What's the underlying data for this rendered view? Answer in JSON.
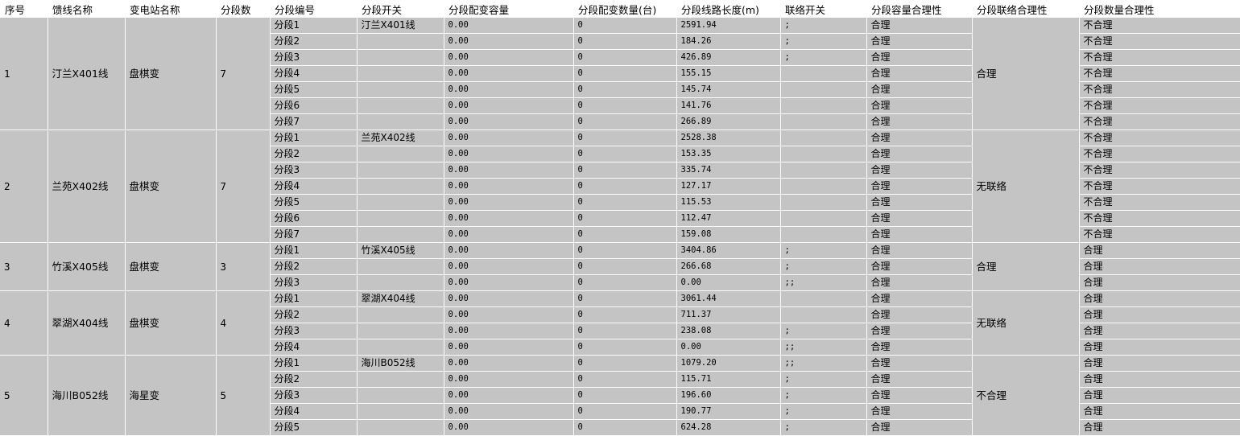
{
  "headers": [
    "序号",
    "馈线名称",
    "变电站名称",
    "分段数",
    "分段编号",
    "分段开关",
    "分段配变容量",
    "分段配变数量(台)",
    "分段线路长度(m)",
    "联络开关",
    "分段容量合理性",
    "分段联络合理性",
    "分段数量合理性"
  ],
  "groups": [
    {
      "index": "1",
      "feeder": "汀兰X401线",
      "substation": "盘棋变",
      "count": "7",
      "link_ok": "合理",
      "rows": [
        {
          "seg": "分段1",
          "switch": "汀兰X401线",
          "cap": "0.00",
          "qty": "0",
          "len": "2591.94",
          "tie": ";",
          "cap_ok": "合理",
          "num_ok": "不合理"
        },
        {
          "seg": "分段2",
          "switch": "",
          "cap": "0.00",
          "qty": "0",
          "len": "184.26",
          "tie": ";",
          "cap_ok": "合理",
          "num_ok": "不合理"
        },
        {
          "seg": "分段3",
          "switch": "",
          "cap": "0.00",
          "qty": "0",
          "len": "426.89",
          "tie": ";",
          "cap_ok": "合理",
          "num_ok": "不合理"
        },
        {
          "seg": "分段4",
          "switch": "",
          "cap": "0.00",
          "qty": "0",
          "len": "155.15",
          "tie": "",
          "cap_ok": "合理",
          "num_ok": "不合理"
        },
        {
          "seg": "分段5",
          "switch": "",
          "cap": "0.00",
          "qty": "0",
          "len": "145.74",
          "tie": "",
          "cap_ok": "合理",
          "num_ok": "不合理"
        },
        {
          "seg": "分段6",
          "switch": "",
          "cap": "0.00",
          "qty": "0",
          "len": "141.76",
          "tie": "",
          "cap_ok": "合理",
          "num_ok": "不合理"
        },
        {
          "seg": "分段7",
          "switch": "",
          "cap": "0.00",
          "qty": "0",
          "len": "266.89",
          "tie": "",
          "cap_ok": "合理",
          "num_ok": "不合理"
        }
      ]
    },
    {
      "index": "2",
      "feeder": "兰苑X402线",
      "substation": "盘棋变",
      "count": "7",
      "link_ok": "无联络",
      "rows": [
        {
          "seg": "分段1",
          "switch": "兰苑X402线",
          "cap": "0.00",
          "qty": "0",
          "len": "2528.38",
          "tie": "",
          "cap_ok": "合理",
          "num_ok": "不合理"
        },
        {
          "seg": "分段2",
          "switch": "",
          "cap": "0.00",
          "qty": "0",
          "len": "153.35",
          "tie": "",
          "cap_ok": "合理",
          "num_ok": "不合理"
        },
        {
          "seg": "分段3",
          "switch": "",
          "cap": "0.00",
          "qty": "0",
          "len": "335.74",
          "tie": "",
          "cap_ok": "合理",
          "num_ok": "不合理"
        },
        {
          "seg": "分段4",
          "switch": "",
          "cap": "0.00",
          "qty": "0",
          "len": "127.17",
          "tie": "",
          "cap_ok": "合理",
          "num_ok": "不合理"
        },
        {
          "seg": "分段5",
          "switch": "",
          "cap": "0.00",
          "qty": "0",
          "len": "115.53",
          "tie": "",
          "cap_ok": "合理",
          "num_ok": "不合理"
        },
        {
          "seg": "分段6",
          "switch": "",
          "cap": "0.00",
          "qty": "0",
          "len": "112.47",
          "tie": "",
          "cap_ok": "合理",
          "num_ok": "不合理"
        },
        {
          "seg": "分段7",
          "switch": "",
          "cap": "0.00",
          "qty": "0",
          "len": "159.08",
          "tie": "",
          "cap_ok": "合理",
          "num_ok": "不合理"
        }
      ]
    },
    {
      "index": "3",
      "feeder": "竹溪X405线",
      "substation": "盘棋变",
      "count": "3",
      "link_ok": "合理",
      "rows": [
        {
          "seg": "分段1",
          "switch": "竹溪X405线",
          "cap": "0.00",
          "qty": "0",
          "len": "3404.86",
          "tie": ";",
          "cap_ok": "合理",
          "num_ok": "合理"
        },
        {
          "seg": "分段2",
          "switch": "",
          "cap": "0.00",
          "qty": "0",
          "len": "266.68",
          "tie": ";",
          "cap_ok": "合理",
          "num_ok": "合理"
        },
        {
          "seg": "分段3",
          "switch": "",
          "cap": "0.00",
          "qty": "0",
          "len": "0.00",
          "tie": ";;",
          "cap_ok": "合理",
          "num_ok": "合理"
        }
      ]
    },
    {
      "index": "4",
      "feeder": "翠湖X404线",
      "substation": "盘棋变",
      "count": "4",
      "link_ok": "无联络",
      "rows": [
        {
          "seg": "分段1",
          "switch": "翠湖X404线",
          "cap": "0.00",
          "qty": "0",
          "len": "3061.44",
          "tie": "",
          "cap_ok": "合理",
          "num_ok": "合理"
        },
        {
          "seg": "分段2",
          "switch": "",
          "cap": "0.00",
          "qty": "0",
          "len": "711.37",
          "tie": "",
          "cap_ok": "合理",
          "num_ok": "合理"
        },
        {
          "seg": "分段3",
          "switch": "",
          "cap": "0.00",
          "qty": "0",
          "len": "238.08",
          "tie": ";",
          "cap_ok": "合理",
          "num_ok": "合理"
        },
        {
          "seg": "分段4",
          "switch": "",
          "cap": "0.00",
          "qty": "0",
          "len": "0.00",
          "tie": ";;",
          "cap_ok": "合理",
          "num_ok": "合理"
        }
      ]
    },
    {
      "index": "5",
      "feeder": "海川B052线",
      "substation": "海星变",
      "count": "5",
      "link_ok": "不合理",
      "rows": [
        {
          "seg": "分段1",
          "switch": "海川B052线",
          "cap": "0.00",
          "qty": "0",
          "len": "1079.20",
          "tie": ";;",
          "cap_ok": "合理",
          "num_ok": "合理"
        },
        {
          "seg": "分段2",
          "switch": "",
          "cap": "0.00",
          "qty": "0",
          "len": "115.71",
          "tie": ";",
          "cap_ok": "合理",
          "num_ok": "合理"
        },
        {
          "seg": "分段3",
          "switch": "",
          "cap": "0.00",
          "qty": "0",
          "len": "196.60",
          "tie": ";",
          "cap_ok": "合理",
          "num_ok": "合理"
        },
        {
          "seg": "分段4",
          "switch": "",
          "cap": "0.00",
          "qty": "0",
          "len": "190.77",
          "tie": ";",
          "cap_ok": "合理",
          "num_ok": "合理"
        },
        {
          "seg": "分段5",
          "switch": "",
          "cap": "0.00",
          "qty": "0",
          "len": "624.28",
          "tie": ";",
          "cap_ok": "合理",
          "num_ok": "合理"
        }
      ]
    }
  ]
}
